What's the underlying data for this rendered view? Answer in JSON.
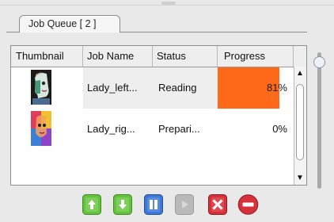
{
  "tab": {
    "label": "Job Queue [ 2 ]"
  },
  "table": {
    "columns": [
      "Thumbnail",
      "Job Name",
      "Status",
      "Progress"
    ],
    "rows": [
      {
        "thumbnail": "lady-left-thumbnail",
        "job_name": "Lady_left...",
        "status": "Reading",
        "progress_label": "81%",
        "progress": 0.81
      },
      {
        "thumbnail": "lady-right-thumbnail",
        "job_name": "Lady_rig...",
        "status": "Prepari...",
        "progress_label": "0%",
        "progress": 0.0
      }
    ]
  },
  "toolbar": {
    "buttons": [
      {
        "icon": "move-up-icon",
        "color": "#63c33a"
      },
      {
        "icon": "move-down-icon",
        "color": "#63c33a"
      },
      {
        "icon": "pause-icon",
        "color": "#3e78d6"
      },
      {
        "icon": "play-icon",
        "color": "#b9b9b9"
      },
      {
        "icon": "cancel-icon",
        "color": "#d6313a"
      },
      {
        "icon": "remove-icon",
        "color": "#d6313a"
      }
    ]
  },
  "colors": {
    "accent_progress": "#ff6a1a",
    "selected_row": "#eeeeee"
  }
}
